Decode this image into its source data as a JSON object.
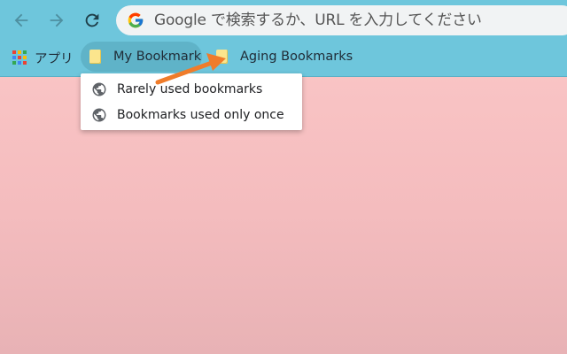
{
  "toolbar": {
    "back_icon": "back-arrow-icon",
    "forward_icon": "forward-arrow-icon",
    "reload_icon": "reload-icon",
    "omnibox": {
      "icon": "google-g-icon",
      "placeholder": "Google で検索するか、URL を入力してください"
    }
  },
  "bookmarks_bar": {
    "apps_label": "アプリ",
    "items": [
      {
        "label": "My Bookmark",
        "icon": "folder-icon",
        "active": true
      },
      {
        "label": "Aging Bookmarks",
        "icon": "folder-icon",
        "active": false
      }
    ]
  },
  "dropdown": {
    "items": [
      {
        "label": "Rarely used bookmarks",
        "icon": "globe-icon"
      },
      {
        "label": "Bookmarks used only once",
        "icon": "globe-icon"
      }
    ]
  },
  "colors": {
    "toolbar": "#6ec6dc",
    "background_top": "#fcc8c8",
    "background_bottom": "#e8b2b5",
    "arrow": "#f07c2a",
    "folder": "#fbe58d"
  }
}
